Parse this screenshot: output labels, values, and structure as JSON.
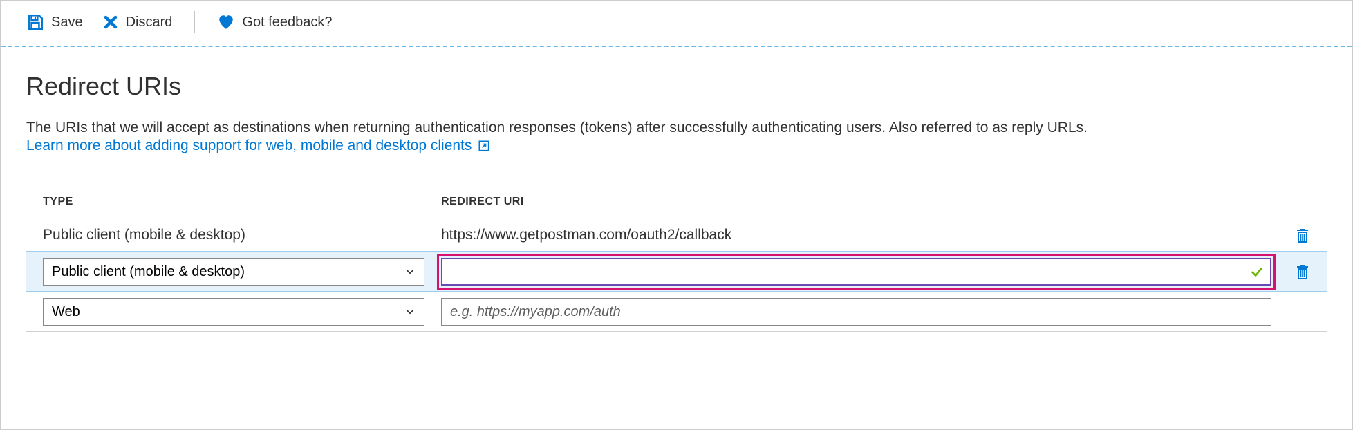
{
  "toolbar": {
    "save_label": "Save",
    "discard_label": "Discard",
    "feedback_label": "Got feedback?"
  },
  "section": {
    "title": "Redirect URIs",
    "description": "The URIs that we will accept as destinations when returning authentication responses (tokens) after successfully authenticating users. Also referred to as reply URLs.",
    "learn_link": "Learn more about adding support for web, mobile and desktop clients"
  },
  "table": {
    "header_type": "TYPE",
    "header_uri": "REDIRECT URI",
    "rows": [
      {
        "type": "Public client (mobile & desktop)",
        "uri": "https://www.getpostman.com/oauth2/callback",
        "mode": "static"
      },
      {
        "type": "Public client (mobile & desktop)",
        "uri": "",
        "placeholder": "",
        "mode": "edit-highlight"
      },
      {
        "type": "Web",
        "uri": "",
        "placeholder": "e.g. https://myapp.com/auth",
        "mode": "edit"
      }
    ]
  }
}
